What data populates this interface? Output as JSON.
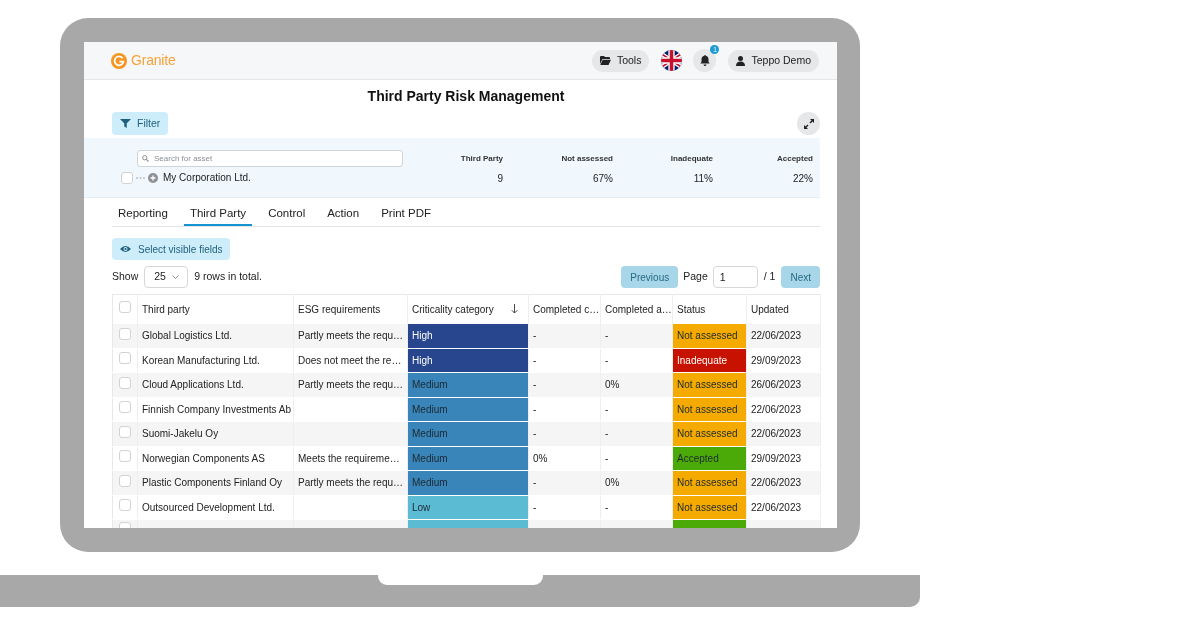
{
  "header": {
    "logo": "Granite",
    "tools_button": "Tools",
    "notifications": {
      "badge": "1"
    },
    "user_button": "Teppo Demo"
  },
  "page_title": "Third Party Risk Management",
  "filter_button": "Filter",
  "summary": {
    "search": {
      "placeholder": "Search for asset"
    },
    "tree": [
      {
        "label": "My Corporation Ltd.",
        "checked": false,
        "expanded": false
      }
    ],
    "stats": [
      {
        "label": "Third Party",
        "value": "9"
      },
      {
        "label": "Not assessed",
        "value": "67%"
      },
      {
        "label": "Inadequate",
        "value": "11%"
      },
      {
        "label": "Accepted",
        "value": "22%"
      }
    ]
  },
  "tabs": [
    {
      "label": "Reporting",
      "selected": false
    },
    {
      "label": "Third Party",
      "selected": true
    },
    {
      "label": "Control",
      "selected": false
    },
    {
      "label": "Action",
      "selected": false
    },
    {
      "label": "Print PDF",
      "selected": false
    }
  ],
  "select_fields_button": "Select visible fields",
  "pagination": {
    "show_label": "Show",
    "page_size": "25",
    "total": "9 rows in total.",
    "previous": "Previous",
    "previous_disabled": true,
    "page_label": "Page",
    "page": "1",
    "page_count": "/ 1",
    "next": "Next",
    "next_disabled": true
  },
  "table": {
    "select_all_checked": false,
    "columns": [
      {
        "label": "Third party",
        "sorted": false
      },
      {
        "label": "ESG requirements",
        "sorted": false
      },
      {
        "label": "Criticality category",
        "sorted": true
      },
      {
        "label": "Completed c…",
        "sorted": false
      },
      {
        "label": "Completed a…",
        "sorted": false
      },
      {
        "label": "Status",
        "sorted": false
      },
      {
        "label": "Updated",
        "sorted": false
      }
    ],
    "rows": [
      {
        "checked": false,
        "third_party": "Global Logistics Ltd.",
        "esg_requirements": "Partly meets the requ…",
        "criticality": {
          "label": "High",
          "color": "#28468e"
        },
        "completed_c": "-",
        "completed_a": "-",
        "status": {
          "label": "Not assessed",
          "color": "#f5aa00"
        },
        "updated": "22/06/2023"
      },
      {
        "checked": false,
        "third_party": "Korean Manufacturing Ltd.",
        "esg_requirements": "Does not meet the re…",
        "criticality": {
          "label": "High",
          "color": "#28468e"
        },
        "completed_c": "-",
        "completed_a": "-",
        "status": {
          "label": "Inadequate",
          "color": "#c81200"
        },
        "updated": "29/09/2023"
      },
      {
        "checked": false,
        "third_party": "Cloud Applications Ltd.",
        "esg_requirements": "Partly meets the requ…",
        "criticality": {
          "label": "Medium",
          "color": "#3984b8"
        },
        "completed_c": "-",
        "completed_a": "0%",
        "status": {
          "label": "Not assessed",
          "color": "#f5aa00"
        },
        "updated": "26/06/2023"
      },
      {
        "checked": false,
        "third_party": "Finnish Company Investments Ab",
        "criticality": {
          "label": "Medium",
          "color": "#3984b8"
        },
        "completed_c": "-",
        "completed_a": "-",
        "status": {
          "label": "Not assessed",
          "color": "#f5aa00"
        },
        "updated": "22/06/2023"
      },
      {
        "checked": false,
        "third_party": "Suomi-Jakelu Oy",
        "criticality": {
          "label": "Medium",
          "color": "#3984b8"
        },
        "completed_c": "-",
        "completed_a": "-",
        "status": {
          "label": "Not assessed",
          "color": "#f5aa00"
        },
        "updated": "22/06/2023"
      },
      {
        "checked": false,
        "third_party": "Norwegian Components AS",
        "esg_requirements": "Meets the requireme…",
        "criticality": {
          "label": "Medium",
          "color": "#3984b8"
        },
        "completed_c": "0%",
        "completed_a": "-",
        "status": {
          "label": "Accepted",
          "color": "#4caa08"
        },
        "updated": "29/09/2023"
      },
      {
        "checked": false,
        "third_party": "Plastic Components Finland Oy",
        "esg_requirements": "Partly meets the requ…",
        "criticality": {
          "label": "Medium",
          "color": "#3984b8"
        },
        "completed_c": "-",
        "completed_a": "0%",
        "status": {
          "label": "Not assessed",
          "color": "#f5aa00"
        },
        "updated": "22/06/2023"
      },
      {
        "checked": false,
        "third_party": "Outsourced Development Ltd.",
        "criticality": {
          "label": "Low",
          "color": "#5bbbd3"
        },
        "completed_c": "-",
        "completed_a": "-",
        "status": {
          "label": "Not assessed",
          "color": "#f5aa00"
        },
        "updated": "22/06/2023"
      },
      {
        "checked": false,
        "criticality": {
          "color": "#5bbbd3"
        },
        "status": {
          "color": "#4caa08"
        }
      }
    ]
  }
}
